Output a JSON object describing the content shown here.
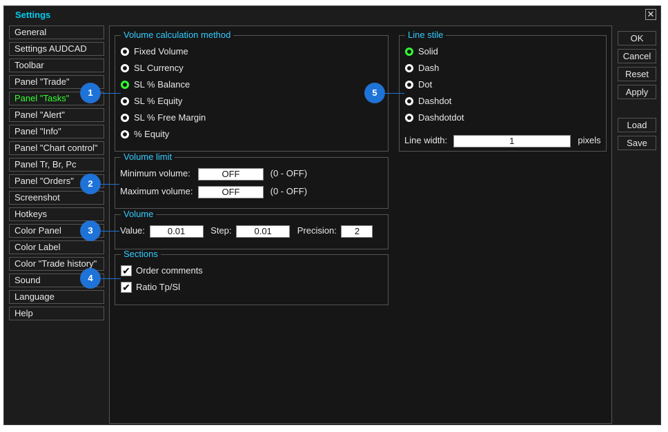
{
  "window": {
    "title": "Settings",
    "close_glyph": "✕"
  },
  "sidebar": {
    "items": [
      {
        "label": "General",
        "active": false
      },
      {
        "label": "Settings AUDCAD",
        "active": false
      },
      {
        "label": "Toolbar",
        "active": false
      },
      {
        "label": "Panel \"Trade\"",
        "active": false
      },
      {
        "label": "Panel \"Tasks\"",
        "active": true
      },
      {
        "label": "Panel \"Alert\"",
        "active": false
      },
      {
        "label": "Panel \"Info\"",
        "active": false
      },
      {
        "label": "Panel \"Chart control\"",
        "active": false
      },
      {
        "label": "Panel Tr, Br, Pc",
        "active": false
      },
      {
        "label": "Panel \"Orders\"",
        "active": false
      },
      {
        "label": "Screenshot",
        "active": false
      },
      {
        "label": "Hotkeys",
        "active": false
      },
      {
        "label": "Color Panel",
        "active": false
      },
      {
        "label": "Color Label",
        "active": false
      },
      {
        "label": "Color \"Trade history\"",
        "active": false
      },
      {
        "label": "Sound",
        "active": false
      },
      {
        "label": "Language",
        "active": false
      },
      {
        "label": "Help",
        "active": false
      }
    ]
  },
  "volume_calc": {
    "title": "Volume calculation method",
    "options": [
      {
        "label": "Fixed Volume",
        "selected": false
      },
      {
        "label": "SL Currency",
        "selected": false
      },
      {
        "label": "SL % Balance",
        "selected": true
      },
      {
        "label": "SL % Equity",
        "selected": false
      },
      {
        "label": "SL % Free Margin",
        "selected": false
      },
      {
        "label": "% Equity",
        "selected": false
      }
    ]
  },
  "volume_limit": {
    "title": "Volume limit",
    "min_label": "Minimum volume:",
    "min_value": "OFF",
    "min_hint": "(0 - OFF)",
    "max_label": "Maximum volume:",
    "max_value": "OFF",
    "max_hint": "(0 - OFF)"
  },
  "volume": {
    "title": "Volume",
    "value_label": "Value:",
    "value": "0.01",
    "step_label": "Step:",
    "step": "0.01",
    "precision_label": "Precision:",
    "precision": "2"
  },
  "sections": {
    "title": "Sections",
    "items": [
      {
        "label": "Order comments",
        "checked": true
      },
      {
        "label": "Ratio Tp/Sl",
        "checked": true
      }
    ]
  },
  "line_style": {
    "title": "Line stile",
    "options": [
      {
        "label": "Solid",
        "selected": true
      },
      {
        "label": "Dash",
        "selected": false
      },
      {
        "label": "Dot",
        "selected": false
      },
      {
        "label": "Dashdot",
        "selected": false
      },
      {
        "label": "Dashdotdot",
        "selected": false
      }
    ],
    "width_label": "Line width:",
    "width_value": "1",
    "width_unit": "pixels"
  },
  "buttons": {
    "ok": "OK",
    "cancel": "Cancel",
    "reset": "Reset",
    "apply": "Apply",
    "load": "Load",
    "save": "Save"
  },
  "markers": {
    "m1": "1",
    "m2": "2",
    "m3": "3",
    "m4": "4",
    "m5": "5"
  },
  "colors": {
    "accent": "#33ccff",
    "active": "#33ff33",
    "marker": "#1e73d8",
    "background": "#1c1c1c"
  }
}
